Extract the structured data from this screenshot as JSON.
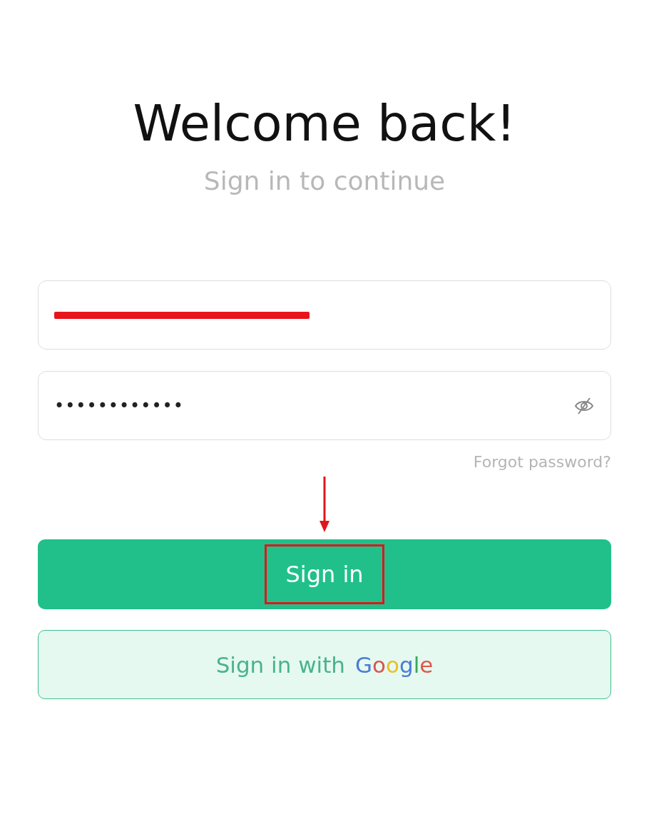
{
  "heading": "Welcome back!",
  "subheading": "Sign in to continue",
  "email_field": {
    "redacted": true
  },
  "password_field": {
    "value": "••••••••••••",
    "password_visible": false
  },
  "forgot_link": "Forgot password?",
  "sign_in_button": {
    "label": "Sign in",
    "highlighted": true
  },
  "google_button": {
    "label": "Sign in with",
    "brand": "Google"
  }
}
